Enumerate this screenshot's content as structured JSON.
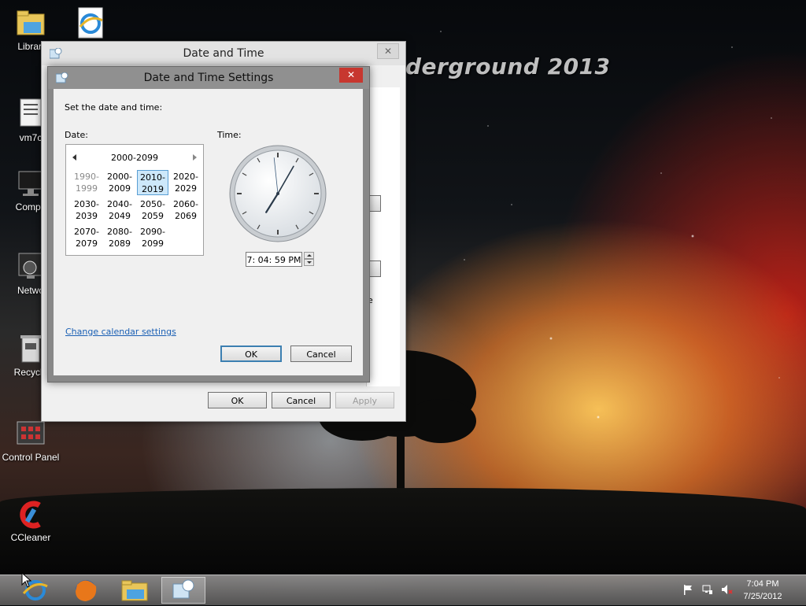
{
  "wallpaper": {
    "text": "derground 2013"
  },
  "desktop_icons": [
    {
      "label": "Librari"
    },
    {
      "label": ""
    },
    {
      "label": "vm7c"
    },
    {
      "label": "Compu"
    },
    {
      "label": "Netwo"
    },
    {
      "label": "Recycle"
    },
    {
      "label": "Control Panel"
    },
    {
      "label": "CCleaner"
    }
  ],
  "outer_dialog": {
    "title": "Date and Time",
    "ok_label": "OK",
    "cancel_label": "Cancel",
    "apply_label": "Apply",
    "apply_enabled": false,
    "edge_text": "e"
  },
  "inner_dialog": {
    "title": "Date and Time Settings",
    "instruction": "Set the date and time:",
    "date_label": "Date:",
    "time_label": "Time:",
    "calendar": {
      "header": "2000-2099",
      "decades": [
        {
          "top": "1990-",
          "bottom": "1999",
          "state": "dim"
        },
        {
          "top": "2000-",
          "bottom": "2009",
          "state": "normal"
        },
        {
          "top": "2010-",
          "bottom": "2019",
          "state": "selected"
        },
        {
          "top": "2020-",
          "bottom": "2029",
          "state": "normal"
        },
        {
          "top": "2030-",
          "bottom": "2039",
          "state": "normal"
        },
        {
          "top": "2040-",
          "bottom": "2049",
          "state": "normal"
        },
        {
          "top": "2050-",
          "bottom": "2059",
          "state": "normal"
        },
        {
          "top": "2060-",
          "bottom": "2069",
          "state": "normal"
        },
        {
          "top": "2070-",
          "bottom": "2079",
          "state": "normal"
        },
        {
          "top": "2080-",
          "bottom": "2089",
          "state": "normal"
        },
        {
          "top": "2090-",
          "bottom": "2099",
          "state": "normal"
        }
      ]
    },
    "time_value": "7: 04: 59 PM",
    "clock": {
      "hour": 7,
      "minute": 4,
      "second": 59
    },
    "change_calendar_link": "Change calendar settings",
    "ok_label": "OK",
    "cancel_label": "Cancel"
  },
  "taskbar": {
    "pinned": [
      "internet-explorer-icon",
      "firefox-icon",
      "file-explorer-icon",
      "date-time-icon"
    ],
    "clock_time": "7:04 PM",
    "clock_date": "7/25/2012"
  },
  "colors": {
    "accent": "#3c7fb1",
    "close_red": "#c7372f",
    "link": "#1a5fb4",
    "selection": "#cde8fa"
  }
}
